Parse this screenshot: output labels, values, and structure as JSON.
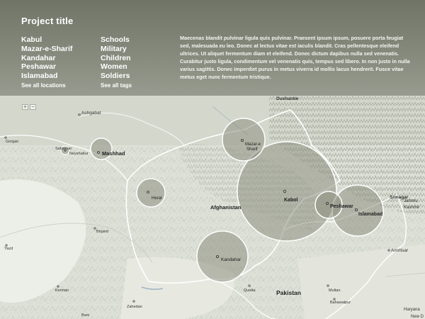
{
  "header": {
    "title": "Project title",
    "locations": [
      "Kabul",
      "Mazar-e-Sharif",
      "Kandahar",
      "Peshawar",
      "Islamabad"
    ],
    "locations_more": "See all locations",
    "tags": [
      "Schools",
      "Military",
      "Children",
      "Women",
      "Soldiers"
    ],
    "tags_more": "See all tags",
    "description": "Maecenas blandit pulvinar ligula quis pulvinar. Praesent ipsum ipsum, posuere porta feugiat sed, malesuada eu leo. Donec at lectus vitae est iaculis blandit. Cras pellentesque eleifend ultrices. Ut aliquet fermentum diam et eleifend. Donec dictum dapibus nulla sed venenatis. Curabitur justo ligula, condimentum vel venenatis quis, tempus sed libero. In non justo in nulla varius sagittis. Donec imperdiet purus in metus viverra id mollis lacus hendrerit. Fusce vitae metus eget nunc fermentum tristique."
  },
  "map": {
    "zoom_in": "+",
    "zoom_out": "−",
    "colors": {
      "bubble": "#8c8f80",
      "bubble_stroke": "#ffffff",
      "border": "#ffffff",
      "land": "#dcdfd6"
    },
    "bubble_labels": {
      "mazar": "Mazar-e\nSharif",
      "kabul": "Kabol",
      "peshawar": "Peshawar",
      "islamabad": "Islamabad",
      "kandahar": "Kandahar",
      "herat": "Herat",
      "mashhad": "Mashhad"
    },
    "places": {
      "dushanbe": "Dushanbe",
      "ashgabat": "Ashgabat",
      "gorgan": "Gorgan",
      "sabzevar": "Sabzevar",
      "neyshabur": "Neyshabur",
      "birjand": "Birjand",
      "yazd": "Yazd",
      "kerman": "Kerman",
      "zahedan": "Zahedan",
      "bam": "Bam",
      "quetta": "Quetta",
      "multan": "Multan",
      "amritsar": "Amritsar",
      "srinagar": "Srinagar",
      "bahawalpur": "Bahawalpur",
      "haryana": "Haryana",
      "new_delhi": "New D",
      "country_afghanistan": "Afghanistan",
      "country_pakistan": "Pakistan",
      "jammu": "Jammu",
      "kashmir": "Kashmir"
    }
  }
}
